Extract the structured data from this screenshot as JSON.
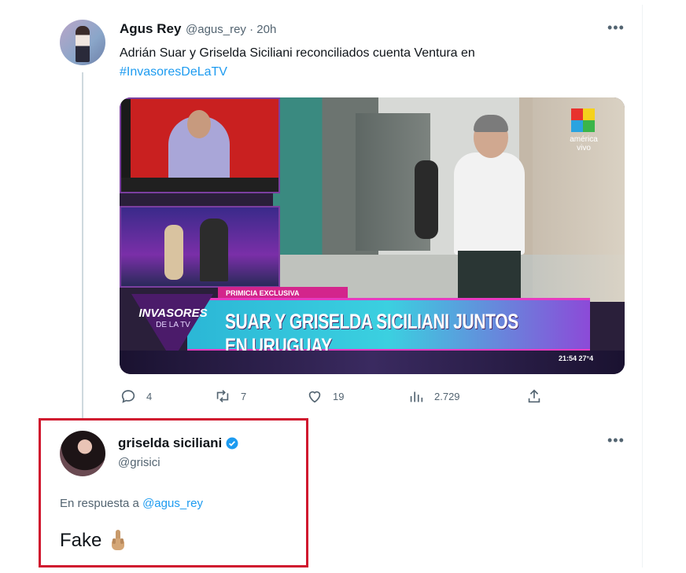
{
  "tweet": {
    "author_name": "Agus Rey",
    "author_handle": "@agus_rey",
    "separator": "·",
    "time": "20h",
    "text": "Adrián Suar y Griselda Siciliani reconciliados cuenta Ventura en",
    "hashtag": "#InvasoresDeLaTV",
    "media": {
      "channel_label": "américa vivo",
      "ticker_top": "PRIMICIA EXCLUSIVA",
      "headline": "SUAR Y GRISELDA SICILIANI JUNTOS EN URUGUAY",
      "show_name": "INVASORES",
      "show_sub": "DE LA TV",
      "clock": "21:54 27°4"
    },
    "stats": {
      "replies": "4",
      "retweets": "7",
      "likes": "19",
      "views": "2.729"
    }
  },
  "reply": {
    "author_name": "griselda siciliani",
    "author_handle": "@grisici",
    "reply_prefix": "En respuesta a",
    "reply_to": "@agus_rey",
    "text": "Fake",
    "emoji": "🖕"
  },
  "colors": {
    "accent": "#1d9bf0",
    "highlight_box": "#d0162e",
    "muted": "#536471"
  }
}
